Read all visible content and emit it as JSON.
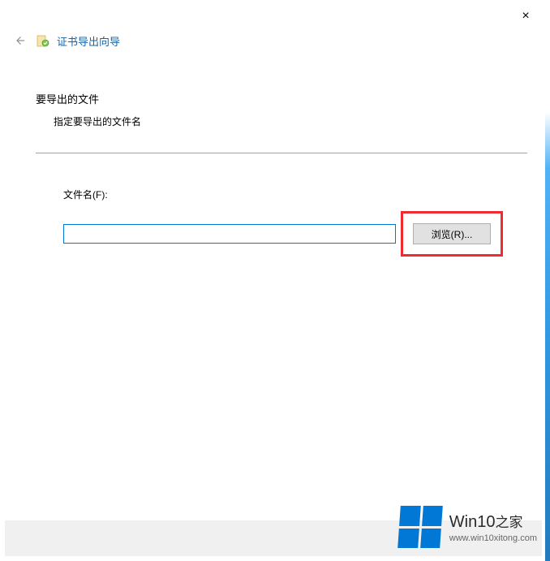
{
  "window": {
    "close_label": "×"
  },
  "header": {
    "title": "证书导出向导"
  },
  "section": {
    "heading": "要导出的文件",
    "subtext": "指定要导出的文件名"
  },
  "file_field": {
    "label": "文件名(F):",
    "value": "",
    "browse_label": "浏览(R)..."
  },
  "watermark": {
    "brand_en": "Win10",
    "brand_zh": "之家",
    "url": "www.win10xitong.com"
  }
}
